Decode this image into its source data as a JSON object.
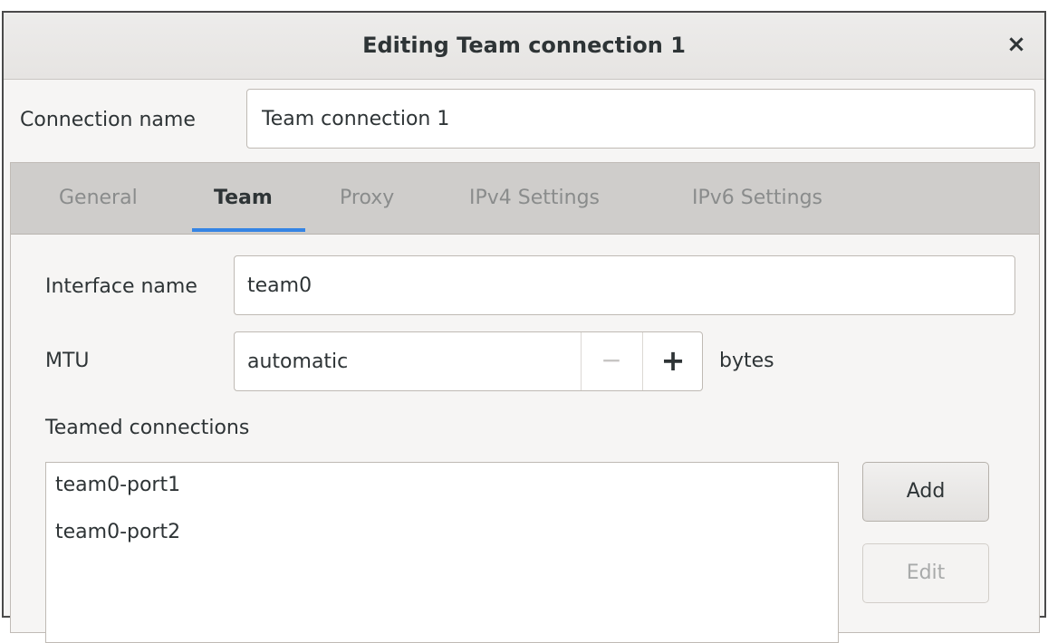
{
  "window": {
    "title": "Editing Team connection 1",
    "close_glyph": "×"
  },
  "connection": {
    "label": "Connection name",
    "value": "Team connection 1"
  },
  "tabs": [
    {
      "label": "General",
      "active": false
    },
    {
      "label": "Team",
      "active": true
    },
    {
      "label": "Proxy",
      "active": false
    },
    {
      "label": "IPv4 Settings",
      "active": false
    },
    {
      "label": "IPv6 Settings",
      "active": false
    }
  ],
  "team": {
    "interface_label": "Interface name",
    "interface_value": "team0",
    "mtu_label": "MTU",
    "mtu_value": "automatic",
    "mtu_minus": "−",
    "mtu_plus": "+",
    "mtu_unit": "bytes",
    "teamed_label": "Teamed connections",
    "teamed_items": [
      "team0-port1",
      "team0-port2"
    ],
    "add_label": "Add",
    "edit_label": "Edit"
  },
  "colors": {
    "accent": "#3584e4",
    "tabbar_bg": "#cfcdcb",
    "window_bg": "#f6f5f4"
  }
}
